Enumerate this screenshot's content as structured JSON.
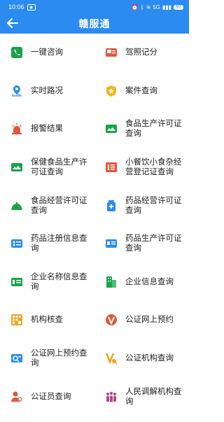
{
  "status": {
    "time": "10:06",
    "signal": "5G",
    "battery": "97"
  },
  "header": {
    "title": "赣服通"
  },
  "items": [
    {
      "label": "一键咨询",
      "icon": "phone-icon",
      "color": "#1aa34a"
    },
    {
      "label": "驾照记分",
      "icon": "license-icon",
      "color": "#e0573b"
    },
    {
      "label": "实时路况",
      "icon": "map-pin-icon",
      "color": "#2c8bf0"
    },
    {
      "label": "案件查询",
      "icon": "star-badge-icon",
      "color": "#f2b51a"
    },
    {
      "label": "报警结果",
      "icon": "alarm-light-icon",
      "color": "#e0573b"
    },
    {
      "label": "食品生产许可证查询",
      "icon": "certificate-icon",
      "color": "#1aa34a"
    },
    {
      "label": "保健食品生产许可证查询",
      "icon": "certificate-icon",
      "color": "#1aa34a"
    },
    {
      "label": "小餐饮小食杂经营登记证查询",
      "icon": "register-icon",
      "color": "#e0573b"
    },
    {
      "label": "食品经营许可证查询",
      "icon": "food-cover-icon",
      "color": "#1aa34a"
    },
    {
      "label": "药品经营许可证查询",
      "icon": "medicine-icon",
      "color": "#2c8bf0"
    },
    {
      "label": "药品注册信息查询",
      "icon": "register-card-icon",
      "color": "#2c8bf0"
    },
    {
      "label": "药品生产许可证查询",
      "icon": "id-card-icon",
      "color": "#2c8bf0"
    },
    {
      "label": "企业名称信息查询",
      "icon": "company-card-icon",
      "color": "#1aa34a"
    },
    {
      "label": "企业信息查询",
      "icon": "building-icon",
      "color": "#1aa34a"
    },
    {
      "label": "机构核查",
      "icon": "grid-check-icon",
      "color": "#f2a21a"
    },
    {
      "label": "公证网上预约",
      "icon": "v-badge-icon",
      "color": "#e0573b"
    },
    {
      "label": "公证网上预约查询",
      "icon": "search-card-icon",
      "color": "#2c8bf0"
    },
    {
      "label": "公证机构查询",
      "icon": "v-search-icon",
      "color": "#f2a21a"
    },
    {
      "label": "公证员查询",
      "icon": "person-search-icon",
      "color": "#e0573b"
    },
    {
      "label": "人民调解机构查询",
      "icon": "people-icon",
      "color": "#b0458a"
    }
  ]
}
